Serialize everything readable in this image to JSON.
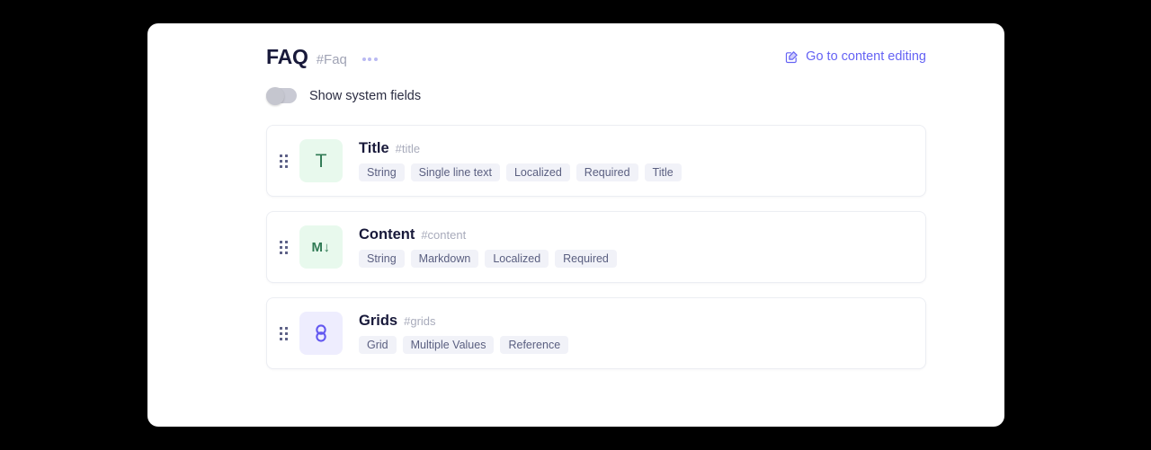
{
  "page": {
    "background_color": "#000000",
    "panel_color": "#ffffff"
  },
  "header": {
    "title": "FAQ",
    "slug": "#Faq",
    "kebab_name": "more-options",
    "edit_link": {
      "label": "Go to content editing",
      "icon": "edit-square-icon",
      "color": "#6563f4"
    }
  },
  "toggle": {
    "label": "Show system fields",
    "checked": false
  },
  "fields": [
    {
      "name": "Title",
      "slug": "#title",
      "icon_glyph": "T",
      "icon_name": "text-type-icon",
      "icon_theme": "green",
      "icon_bg": "#e8f9ed",
      "icon_fg": "#2f7a54",
      "tags": [
        "String",
        "Single line text",
        "Localized",
        "Required",
        "Title"
      ]
    },
    {
      "name": "Content",
      "slug": "#content",
      "icon_glyph": "M↓",
      "icon_name": "markdown-type-icon",
      "icon_theme": "green",
      "icon_bg": "#e8f9ed",
      "icon_fg": "#2f7a54",
      "tags": [
        "String",
        "Markdown",
        "Localized",
        "Required"
      ]
    },
    {
      "name": "Grids",
      "slug": "#grids",
      "icon_glyph": "link",
      "icon_name": "reference-link-icon",
      "icon_theme": "purple",
      "icon_bg": "#eeedfe",
      "icon_fg": "#6257f0",
      "tags": [
        "Grid",
        "Multiple Values",
        "Reference"
      ]
    }
  ]
}
